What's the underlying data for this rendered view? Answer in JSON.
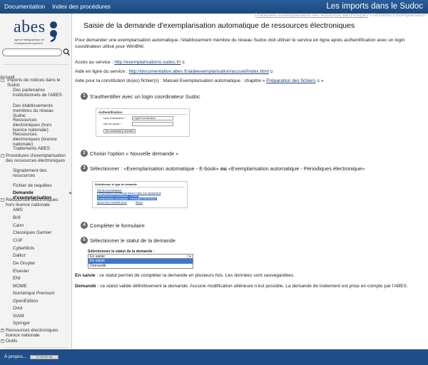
{
  "topbar": {
    "nav": [
      "Documentation",
      "Index des procédures"
    ],
    "site_title": "Les imports dans le Sudoc"
  },
  "logo": {
    "word": "abes",
    "subtitle": "agence bibliographique de l'enseignement supérieur"
  },
  "sidebar": {
    "items": [
      {
        "label": "Accueil",
        "toggle": ""
      },
      {
        "label": "Imports de notices dans le Sudoc",
        "toggle": "-"
      },
      {
        "label": "Des partenaires institutionnels de l'ABES",
        "toggle": ""
      },
      {
        "label": "Des établissements membres du réseau Sudoc",
        "toggle": ""
      },
      {
        "label": "Ressources électroniques (hors licence nationale)",
        "toggle": ""
      },
      {
        "label": "Ressources électroniques (licence nationale)",
        "toggle": ""
      },
      {
        "label": "Traitements ABES",
        "toggle": ""
      },
      {
        "label": "Procédures d'exemplarisation des ressources électroniques",
        "toggle": "-"
      },
      {
        "label": "Signalement des ressources",
        "toggle": ""
      },
      {
        "label": "Fichier de requêtes",
        "toggle": ""
      },
      {
        "label": "Demande d'exemplarisation",
        "toggle": ""
      },
      {
        "label": "Ressources électroniques hors licence nationale",
        "toggle": "-"
      },
      {
        "label": "AMS",
        "toggle": ""
      },
      {
        "label": "Brill",
        "toggle": ""
      },
      {
        "label": "Cairn",
        "toggle": ""
      },
      {
        "label": "Classiques Garnier",
        "toggle": ""
      },
      {
        "label": "CUP",
        "toggle": ""
      },
      {
        "label": "Cyberlibris",
        "toggle": ""
      },
      {
        "label": "Dalloz",
        "toggle": ""
      },
      {
        "label": "De Gruyter",
        "toggle": ""
      },
      {
        "label": "Elsevier",
        "toggle": ""
      },
      {
        "label": "ENI",
        "toggle": ""
      },
      {
        "label": "MOME",
        "toggle": ""
      },
      {
        "label": "Numérique Premium",
        "toggle": ""
      },
      {
        "label": "OpenEdition",
        "toggle": ""
      },
      {
        "label": "Ovid",
        "toggle": ""
      },
      {
        "label": "SIAM",
        "toggle": ""
      },
      {
        "label": "Springer",
        "toggle": ""
      },
      {
        "label": "Ressources électroniques licence nationale",
        "toggle": "+"
      },
      {
        "label": "Outils",
        "toggle": "+"
      }
    ]
  },
  "breadcrumb": {
    "link": "Procédures d'exemplarisation des ressources électroniques",
    "sep": " » ",
    "current": "Demande d'exemplarisation"
  },
  "content": {
    "title": "Saisie de la demande d'exemplarisation automatique de ressources électroniques",
    "intro": "Pour demander une exemplarisation automatique, l'établissement membre du réseau Sudoc doit utiliser le service en ligne après authentification avec un login coordinateur utilisé pour WinIBW.",
    "access_label": "Accès au service : ",
    "access_url": "http://exemplarisations.sudoc.fr/",
    "help_label": "Aide en ligne du service : ",
    "help_url": "http://documentation.abes.fr/aideexemplarisation/accueil/index.html",
    "manual_label": "Aide pour la constitution du(es) fichier(s) : Manuel Exemplarisation automatique : chapitre « ",
    "manual_link": "Préparation des fichiers",
    "manual_end": " »",
    "steps": [
      {
        "num": "1",
        "text": "S'authentifier avec un login coordinateur Sudoc"
      },
      {
        "num": "2",
        "text": "Choisir l'option « Nouvelle demande »"
      },
      {
        "num": "3",
        "text_a": "Sélectionner : «Exemplarisation automatique - E-book»",
        "bold": " ou ",
        "text_b": "«Exemplarisation automatique - Périodiques électronique»"
      },
      {
        "num": "4",
        "text": "Compléter le formulaire"
      },
      {
        "num": "5",
        "text": "Sélectionner le statut de la demande"
      }
    ],
    "shot1": {
      "heading": "Authentification",
      "user_label": "Nom d'utilisateur *",
      "user_value": "LoginCoordinateur",
      "pass_label": "Mot de passe *",
      "btn_connect": "Se connecter",
      "btn_cancel": "Annuler"
    },
    "shot2": {
      "heading": "Sélectionner le type de demande",
      "options": [
        "Test de reconnaissance",
        "Exemplarisation automatique dans le cadre d'un abonnement",
        "Exemplarisation automatique - E-book",
        "Exemplarisation automatique - Périodiques électronique",
        "Ajout d'une 4 nouvelle revue",
        "Retour"
      ]
    },
    "dropdown": {
      "label": "Sélectionnez le statut de la demande :",
      "value": "En saisie",
      "options": [
        "En saisie",
        "Demandé"
      ]
    },
    "def1_term": "En saisie",
    "def1_text": " : ce statut permet de compléter la demande en plusieurs fois. Les données sont sauvegardées.",
    "def2_term": "Demandé",
    "def2_text": " : ce statut valide définitivement la demande. Aucune modification ultérieure n'est possible. La demande de traitement est prise en compte par l'ABES."
  },
  "footer": {
    "about": "À propos...",
    "badge": "CC BY-NC-SA"
  },
  "colors": {
    "topbar": "#1c4a80",
    "footer": "#1f4e8a",
    "link": "#1a3f7a",
    "selected_option": "#3a78d0"
  }
}
